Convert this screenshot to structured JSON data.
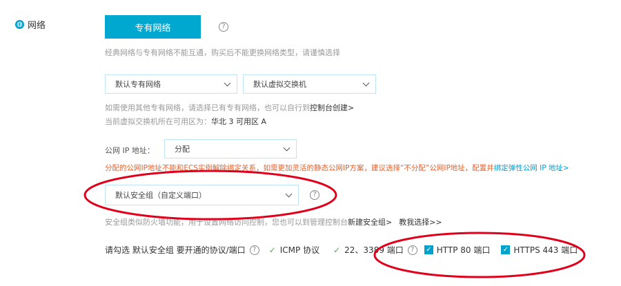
{
  "section": {
    "label": "网络",
    "icon": "globe-icon"
  },
  "network_tab": {
    "label": "专有网络"
  },
  "help_icon_glyph": "?",
  "note_network_type": "经典网络与专有网络不能互通，购买后不能更换网络类型，请谨慎选择",
  "vpc_select": {
    "value": "默认专有网络"
  },
  "vswitch_select": {
    "value": "默认虚拟交换机"
  },
  "vpc_note": {
    "text": "如需使用其他专有网络，请选择已有专有网络，也可以自行到",
    "link": "控制台创建>"
  },
  "zone_note": {
    "prefix": "当前虚拟交换机所在可用区为：",
    "zone": "华北 3 可用区 A"
  },
  "public_ip": {
    "label": "公网 IP 地址：",
    "value": "分配"
  },
  "ip_warning": {
    "text": "分配的公网IP地址不能和ECS实例解除绑定关系，如需更加灵活的静态公网IP方案，建议选择“不分配”公网IP地址，配置并",
    "link": "绑定弹性公网 IP 地址>"
  },
  "security_group_select": {
    "value": "默认安全组（自定义端口）"
  },
  "sg_note": {
    "text": "安全组类似防火墙功能，用于设置网络访问控制，您也可以到管理控制台",
    "link1": "新建安全组>",
    "link2": "教我选择>>"
  },
  "ports": {
    "label": "请勾选 默认安全组 要开通的协议/端口",
    "icmp": "ICMP 协议",
    "ssh_rdp": "22、3389 端口",
    "http": "HTTP 80 端口",
    "https": "HTTPS 443 端口"
  },
  "colors": {
    "accent": "#00a8d0",
    "annotation": "#e0001b",
    "warning": "#e8612c",
    "success": "#5aa55a"
  }
}
